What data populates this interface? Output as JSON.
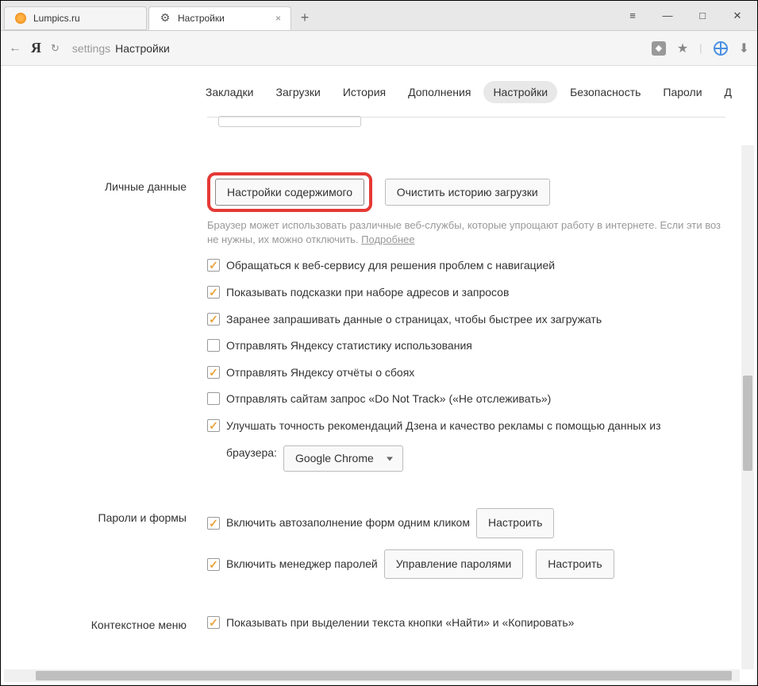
{
  "tabs": [
    {
      "title": "Lumpics.ru",
      "favicon": "orange"
    },
    {
      "title": "Настройки",
      "favicon": "gear",
      "active": true
    }
  ],
  "address": {
    "domain": "settings",
    "path": "Настройки"
  },
  "topnav": {
    "items": [
      "Закладки",
      "Загрузки",
      "История",
      "Дополнения",
      "Настройки",
      "Безопасность",
      "Пароли",
      "Д"
    ],
    "active_index": 4
  },
  "sections": {
    "personal": {
      "title": "Личные данные",
      "content_settings_btn": "Настройки содержимого",
      "clear_history_btn": "Очистить историю загрузки",
      "help_text": "Браузер может использовать различные веб-службы, которые упрощают работу в интернете. Если эти воз не нужны, их можно отключить. ",
      "help_link": "Подробнее",
      "checks": [
        {
          "checked": true,
          "label": "Обращаться к веб-сервису для решения проблем с навигацией"
        },
        {
          "checked": true,
          "label": "Показывать подсказки при наборе адресов и запросов"
        },
        {
          "checked": true,
          "label": "Заранее запрашивать данные о страницах, чтобы быстрее их загружать"
        },
        {
          "checked": false,
          "label": "Отправлять Яндексу статистику использования"
        },
        {
          "checked": true,
          "label": "Отправлять Яндексу отчёты о сбоях"
        },
        {
          "checked": false,
          "label": "Отправлять сайтам запрос «Do Not Track» («Не отслеживать»)"
        },
        {
          "checked": true,
          "label": "Улучшать точность рекомендаций Дзена и качество рекламы с помощью данных из"
        }
      ],
      "browser_label": "браузера:",
      "browser_select": "Google Chrome"
    },
    "passwords": {
      "title": "Пароли и формы",
      "rows": [
        {
          "checked": true,
          "label": "Включить автозаполнение форм одним кликом",
          "buttons": [
            "Настроить"
          ]
        },
        {
          "checked": true,
          "label": "Включить менеджер паролей",
          "buttons": [
            "Управление паролями",
            "Настроить"
          ]
        }
      ]
    },
    "contextmenu": {
      "title": "Контекстное меню",
      "row": {
        "checked": true,
        "label": "Показывать при выделении текста кнопки «Найти» и «Копировать»"
      }
    }
  },
  "menu_glyph": "≡"
}
